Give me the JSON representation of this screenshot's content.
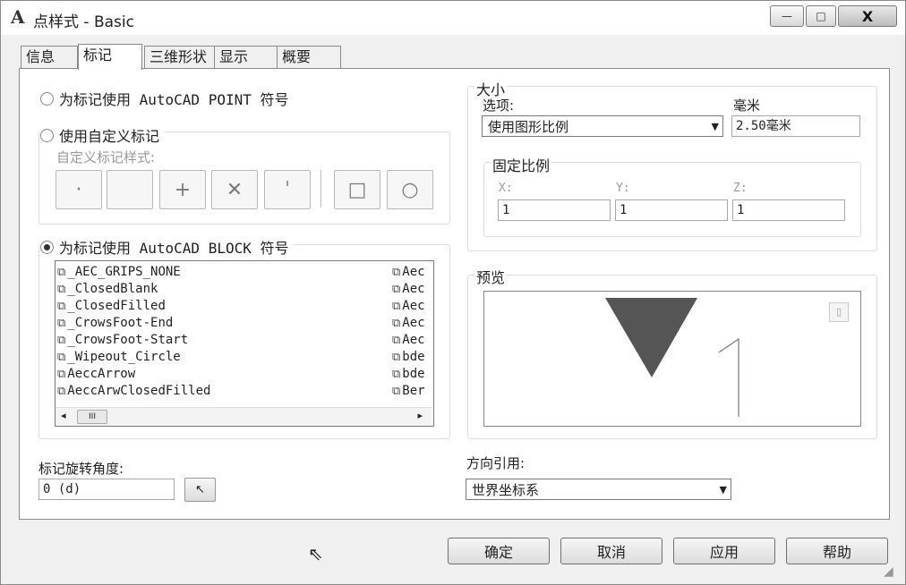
{
  "window": {
    "app_icon": "A",
    "title": "点样式 - Basic",
    "minimize": "—",
    "maximize": "□",
    "close": "X"
  },
  "tabs": [
    {
      "label": "信息"
    },
    {
      "label": "标记"
    },
    {
      "label": "三维形状"
    },
    {
      "label": "显示"
    },
    {
      "label": "概要"
    }
  ],
  "marker": {
    "option_point": "为标记使用 AutoCAD POINT 符号",
    "option_custom": "使用自定义标记",
    "custom_style_label": "自定义标记样式:",
    "option_block": "为标记使用 AutoCAD BLOCK 符号",
    "selected_option": "block",
    "style_buttons": [
      {
        "name": "dot",
        "glyph": "·"
      },
      {
        "name": "none",
        "glyph": ""
      },
      {
        "name": "plus",
        "glyph": "+"
      },
      {
        "name": "x",
        "glyph": "✕"
      },
      {
        "name": "tick",
        "glyph": "ˈ"
      },
      {
        "name": "square",
        "glyph": "□"
      },
      {
        "name": "circle",
        "glyph": "○"
      }
    ]
  },
  "block_list": {
    "col1": [
      "_AEC_GRIPS_NONE",
      "_ClosedBlank",
      "_ClosedFilled",
      "_CrowsFoot-End",
      "_CrowsFoot-Start",
      "_Wipeout_Circle",
      "AeccArrow",
      "AeccArwClosedFilled"
    ],
    "col2": [
      "Aec",
      "Aec",
      "Aec",
      "Aec",
      "Aec",
      "bde",
      "bde",
      "Ber"
    ],
    "scroll_left": "◂",
    "scroll_thumb": "III",
    "scroll_right": "▸"
  },
  "size": {
    "legend": "大小",
    "option_label": "选项:",
    "option_value": "使用图形比例",
    "mm_label": "毫米",
    "mm_value": "2.50毫米",
    "fixed_scale_legend": "固定比例",
    "x_label": "X:",
    "x_value": "1",
    "y_label": "Y:",
    "y_value": "1",
    "z_label": "Z:",
    "z_value": "1"
  },
  "preview": {
    "legend": "预览",
    "corner_button": "▯"
  },
  "rotation": {
    "label": "标记旋转角度:",
    "value": "0 (d)",
    "pick_icon": "↖"
  },
  "orientation": {
    "label": "方向引用:",
    "value": "世界坐标系"
  },
  "buttons": {
    "ok": "确定",
    "cancel": "取消",
    "apply": "应用",
    "help": "帮助"
  },
  "colors": {
    "preview_marker": "#555555",
    "panel_bg": "#ffffff",
    "window_bg": "#f0f0f0"
  }
}
